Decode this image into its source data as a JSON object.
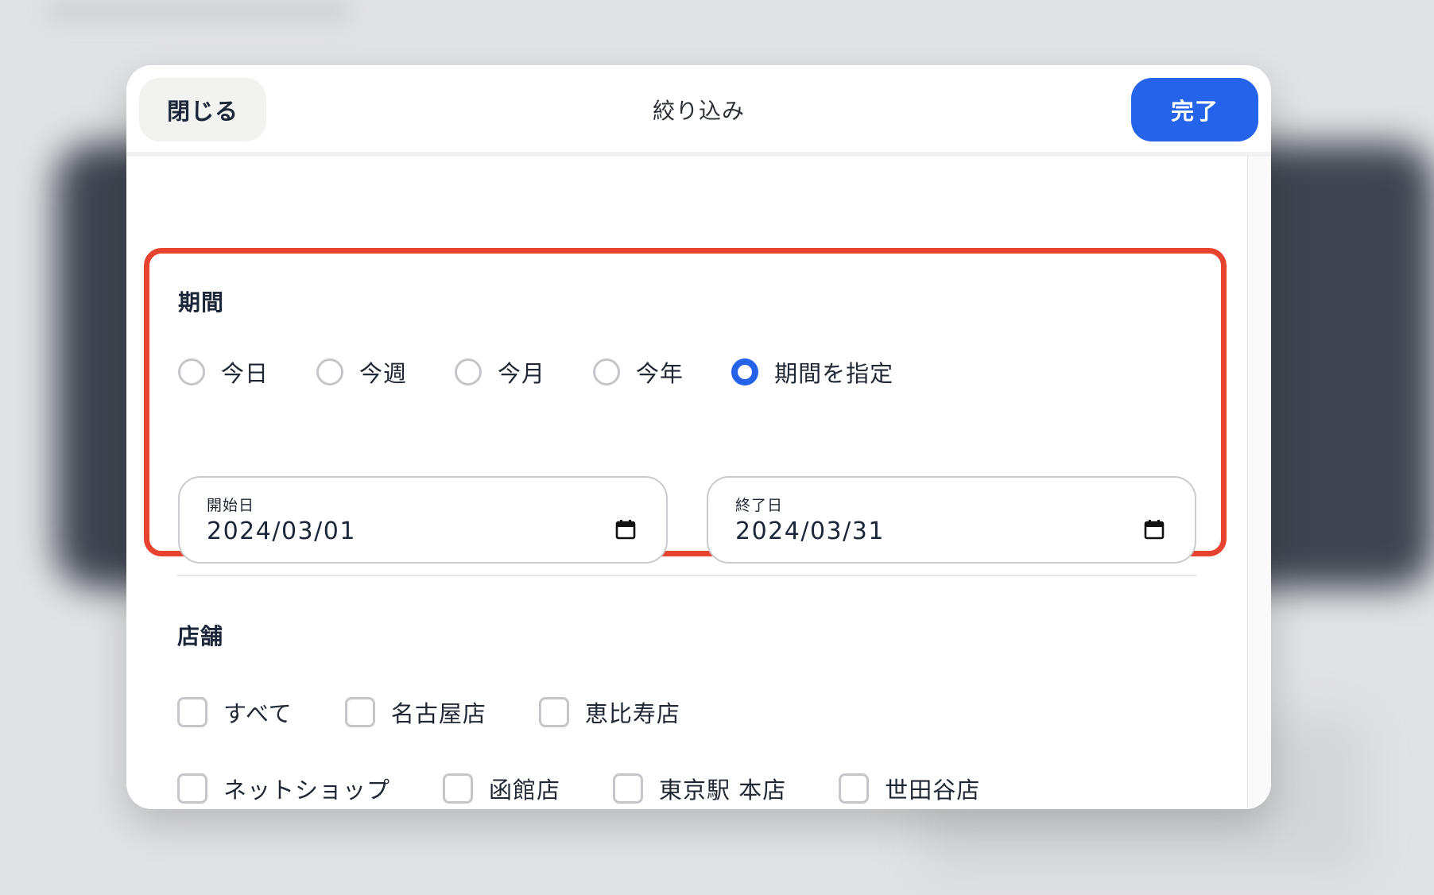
{
  "header": {
    "close_label": "閉じる",
    "title": "絞り込み",
    "done_label": "完了"
  },
  "period": {
    "title": "期間",
    "options": [
      {
        "label": "今日",
        "selected": false
      },
      {
        "label": "今週",
        "selected": false
      },
      {
        "label": "今月",
        "selected": false
      },
      {
        "label": "今年",
        "selected": false
      },
      {
        "label": "期間を指定",
        "selected": true
      }
    ],
    "start": {
      "label": "開始日",
      "value": "2024/03/01"
    },
    "end": {
      "label": "終了日",
      "value": "2024/03/31"
    }
  },
  "stores": {
    "title": "店舗",
    "row1": [
      {
        "label": "すべて",
        "checked": false
      },
      {
        "label": "名古屋店",
        "checked": false
      },
      {
        "label": "恵比寿店",
        "checked": false
      }
    ],
    "row2": [
      {
        "label": "ネットショップ",
        "checked": false
      },
      {
        "label": "函館店",
        "checked": false
      },
      {
        "label": "東京駅 本店",
        "checked": false
      },
      {
        "label": "世田谷店",
        "checked": false
      }
    ]
  },
  "colors": {
    "accent": "#2563eb",
    "highlight": "#e8432e",
    "text": "#1b2638"
  },
  "icons": {
    "date_picker": "calendar-icon"
  }
}
